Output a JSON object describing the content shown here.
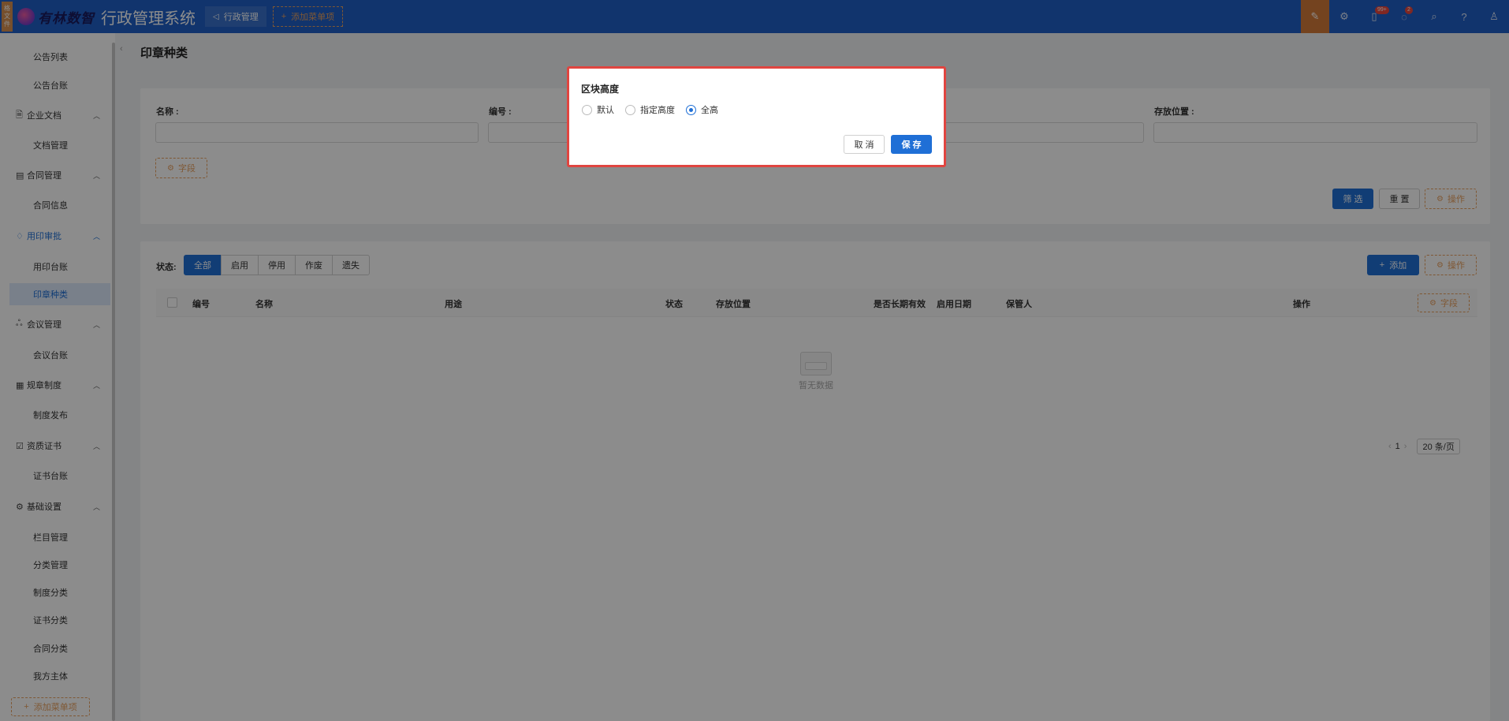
{
  "topbar": {
    "side_tag": "格文件",
    "logo_text": "有林数智",
    "app_title": "行政管理系统",
    "nav_tab": "行政管理",
    "add_menu": "添加菜单项",
    "badges": {
      "notifications": "99+",
      "messages": "2"
    },
    "icons": [
      "pen-icon",
      "settings-icon",
      "bell-icon",
      "message-icon",
      "search-icon",
      "help-icon",
      "user-icon"
    ]
  },
  "sidebar": {
    "items": [
      {
        "type": "sub",
        "label": "公告列表"
      },
      {
        "type": "sub",
        "label": "公告台账"
      },
      {
        "type": "group",
        "label": "企业文档",
        "icon": "document-icon"
      },
      {
        "type": "sub",
        "label": "文档管理"
      },
      {
        "type": "group",
        "label": "合同管理",
        "icon": "contract-icon"
      },
      {
        "type": "sub",
        "label": "合同信息"
      },
      {
        "type": "group",
        "label": "用印审批",
        "icon": "seal-icon",
        "active": true
      },
      {
        "type": "sub",
        "label": "用印台账"
      },
      {
        "type": "sub",
        "label": "印章种类",
        "selected": true
      },
      {
        "type": "group",
        "label": "会议管理",
        "icon": "meeting-icon"
      },
      {
        "type": "sub",
        "label": "会议台账"
      },
      {
        "type": "group",
        "label": "规章制度",
        "icon": "rules-icon"
      },
      {
        "type": "sub",
        "label": "制度发布"
      },
      {
        "type": "group",
        "label": "资质证书",
        "icon": "certificate-icon"
      },
      {
        "type": "sub",
        "label": "证书台账"
      },
      {
        "type": "group",
        "label": "基础设置",
        "icon": "gear-icon"
      },
      {
        "type": "sub",
        "label": "栏目管理"
      },
      {
        "type": "sub",
        "label": "分类管理"
      },
      {
        "type": "sub",
        "label": "制度分类"
      },
      {
        "type": "sub",
        "label": "证书分类"
      },
      {
        "type": "sub",
        "label": "合同分类"
      },
      {
        "type": "sub",
        "label": "我方主体"
      }
    ],
    "add_menu": "添加菜单项"
  },
  "page": {
    "title": "印章种类"
  },
  "filter": {
    "name_label": "名称 :",
    "code_label": "编号 :",
    "location_label": "存放位置 :",
    "field_btn": "字段",
    "filter_btn": "筛 选",
    "reset_btn": "重 置",
    "ops_btn": "操作"
  },
  "table": {
    "status_label": "状态:",
    "status_tabs": [
      "全部",
      "启用",
      "停用",
      "作废",
      "遗失"
    ],
    "add_btn": "添加",
    "ops_btn": "操作",
    "field_btn": "字段",
    "columns": [
      "编号",
      "名称",
      "用途",
      "状态",
      "存放位置",
      "是否长期有效",
      "启用日期",
      "保管人",
      "操作"
    ],
    "rows": [],
    "empty_text": "暂无数据",
    "pagination": {
      "page": "1",
      "page_size": "20 条/页"
    }
  },
  "modal": {
    "title": "区块高度",
    "options": [
      "默认",
      "指定高度",
      "全高"
    ],
    "selected": "全高",
    "cancel": "取 消",
    "save": "保 存"
  }
}
